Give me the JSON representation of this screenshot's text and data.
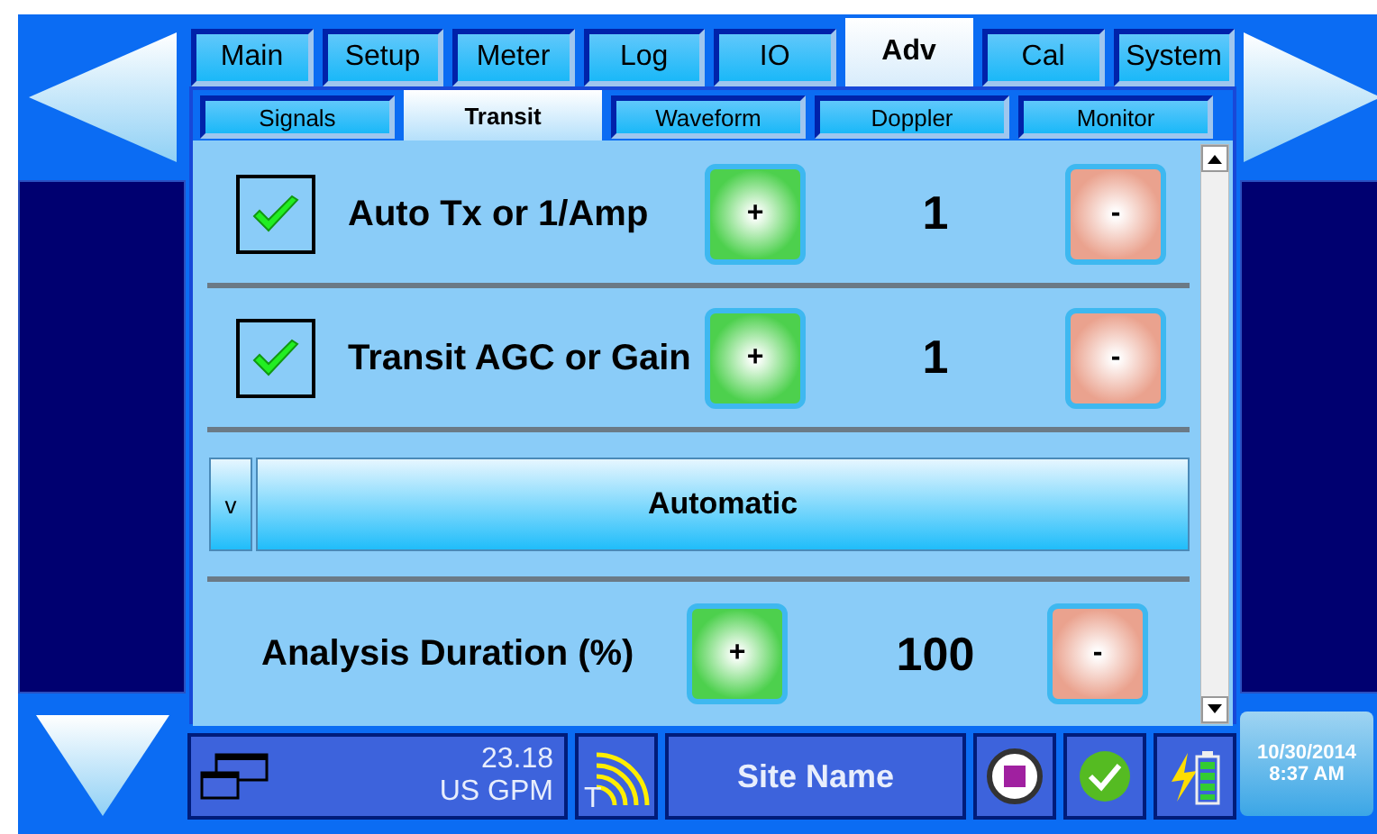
{
  "tabs": [
    {
      "label": "Main",
      "selected": false
    },
    {
      "label": "Setup",
      "selected": false
    },
    {
      "label": "Meter",
      "selected": false
    },
    {
      "label": "Log",
      "selected": false
    },
    {
      "label": "IO",
      "selected": false
    },
    {
      "label": "Adv",
      "selected": true
    },
    {
      "label": "Cal",
      "selected": false
    },
    {
      "label": "System",
      "selected": false
    }
  ],
  "subtabs": [
    {
      "label": "Signals",
      "selected": false
    },
    {
      "label": "Transit",
      "selected": true
    },
    {
      "label": "Waveform",
      "selected": false
    },
    {
      "label": "Doppler",
      "selected": false
    },
    {
      "label": "Monitor",
      "selected": false
    }
  ],
  "settings": [
    {
      "kind": "check-stepper",
      "label": "Auto Tx or 1/Amp",
      "checked": true,
      "plus": "+",
      "value": "1",
      "minus": "-"
    },
    {
      "kind": "check-stepper",
      "label": "Transit AGC or Gain",
      "checked": true,
      "plus": "+",
      "value": "1",
      "minus": "-"
    },
    {
      "kind": "dropdown",
      "arrow": "v",
      "value": "Automatic"
    },
    {
      "kind": "stepper",
      "label": "Analysis Duration (%)",
      "plus": "+",
      "value": "100",
      "minus": "-"
    }
  ],
  "status_bar": {
    "flow_value": "23.18",
    "flow_unit": "US GPM",
    "signal_label": "T",
    "site_name": "Site Name",
    "date": "10/30/2014",
    "time": "8:37 AM"
  }
}
